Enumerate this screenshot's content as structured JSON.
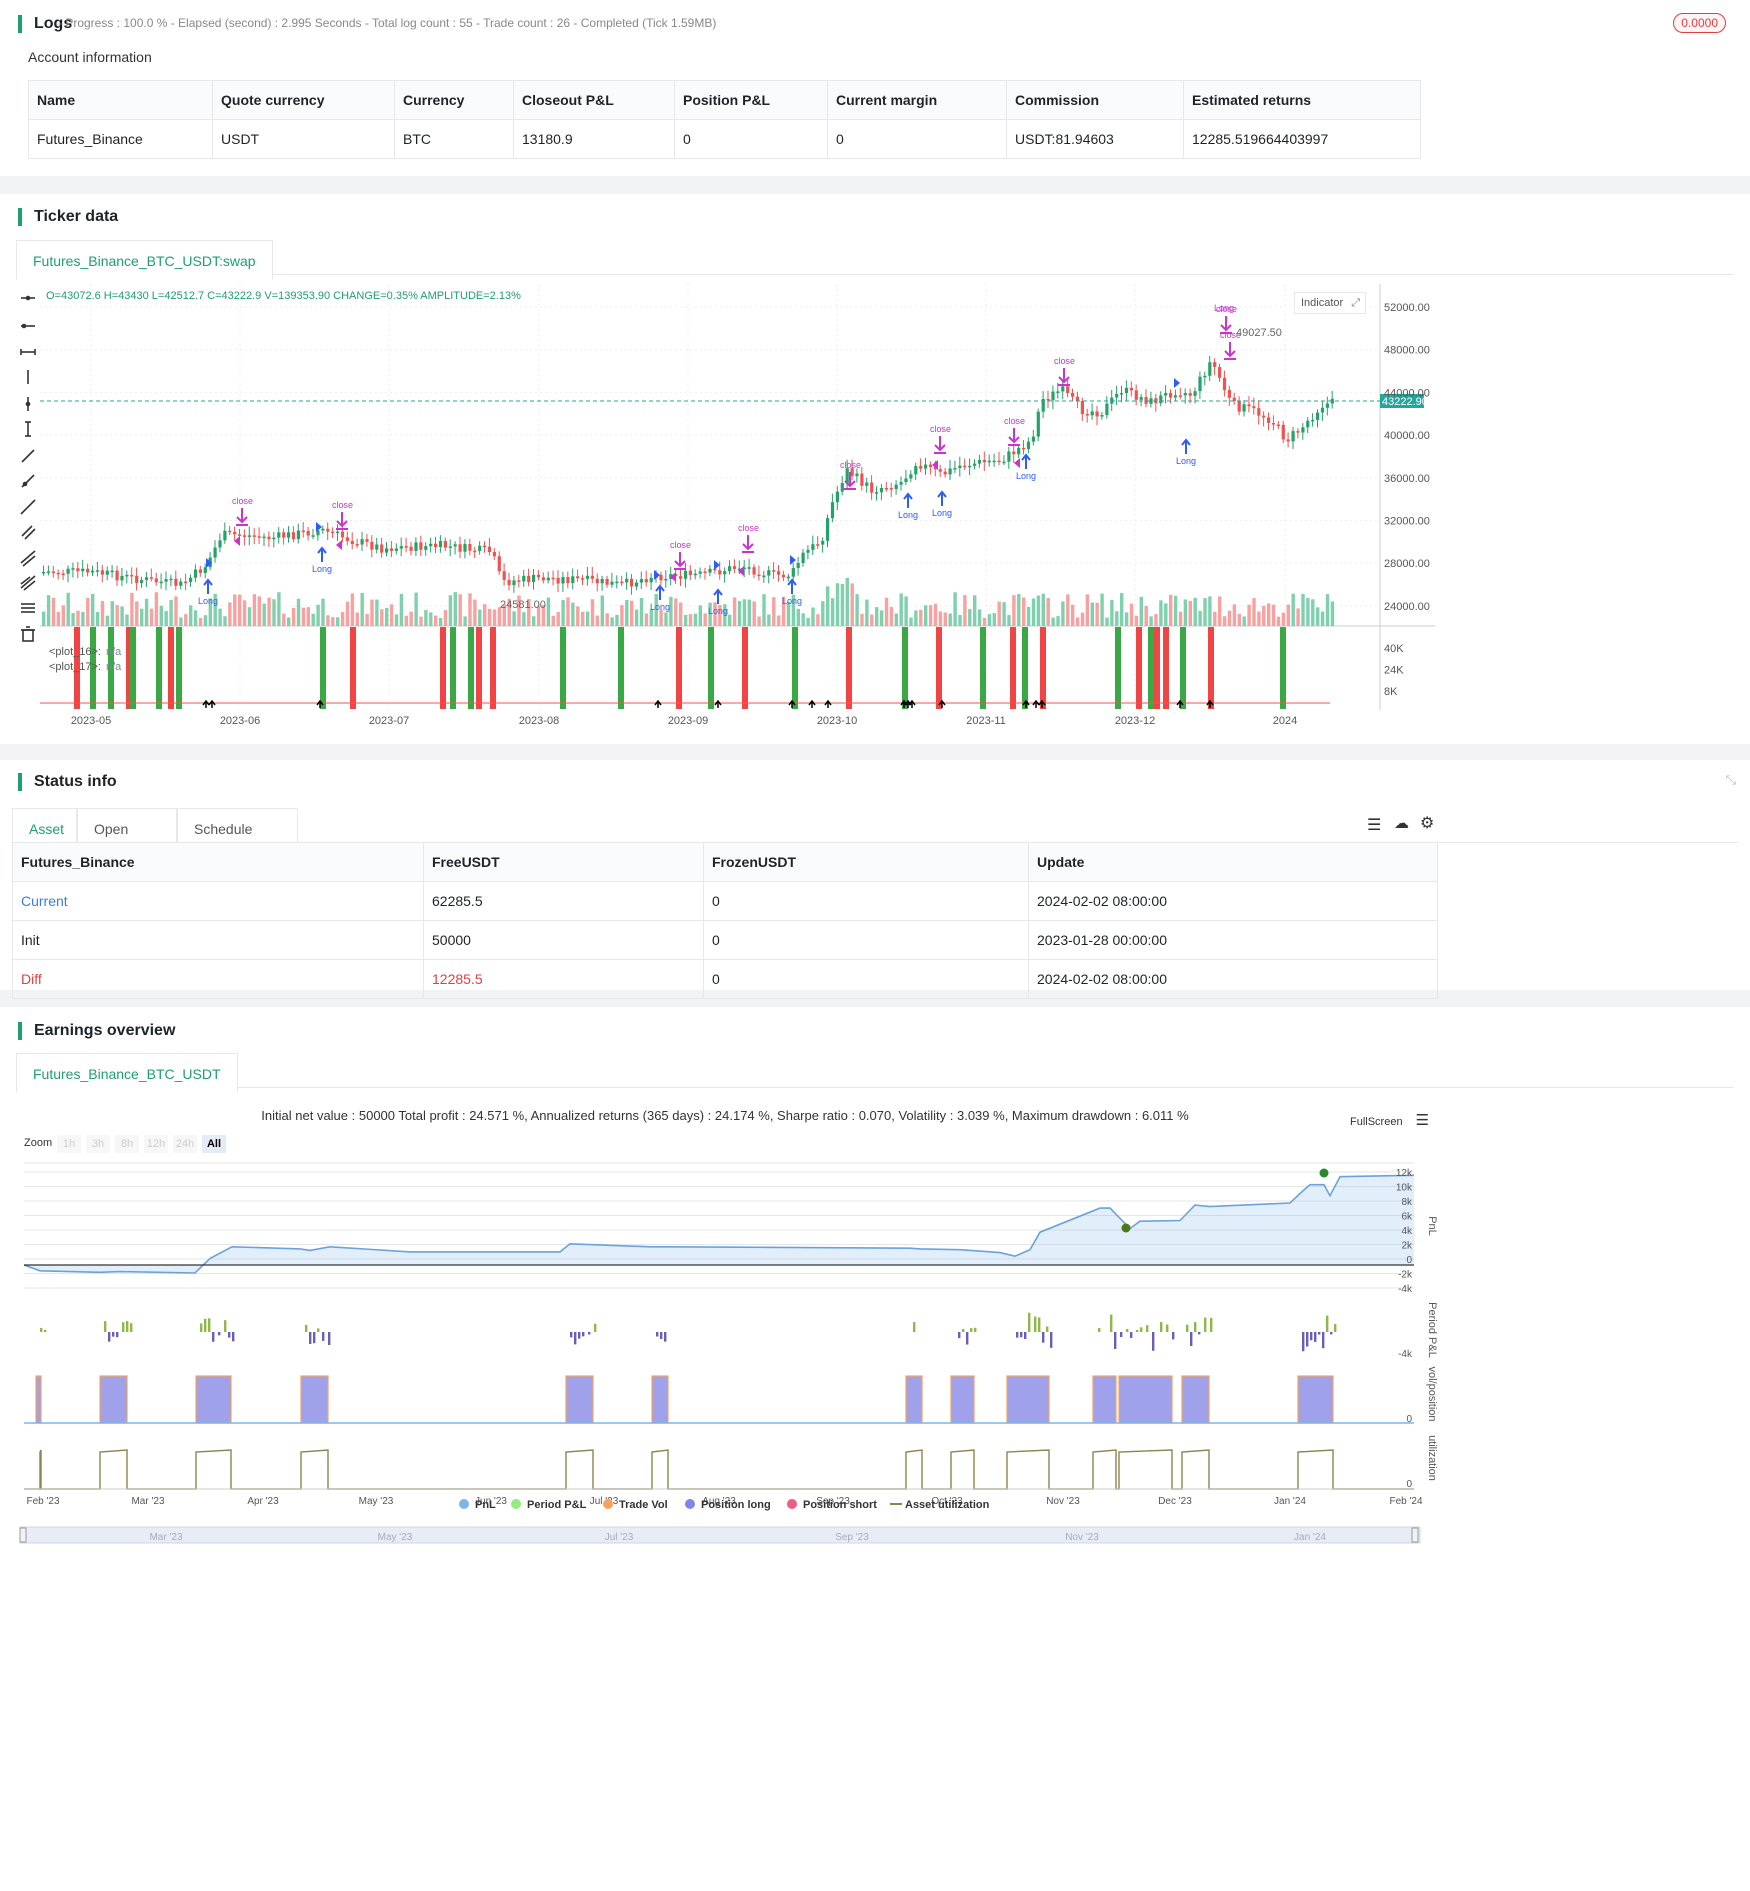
{
  "logs": {
    "title": "Logs",
    "status": "- Progress : 100.0 % - Elapsed (second) : 2.995  Seconds - Total log count : 55 - Trade count : 26 - Completed (Tick 1.59MB)",
    "badge": "0.0000",
    "account_title": "Account information",
    "table": {
      "headers": [
        "Name",
        "Quote currency",
        "Currency",
        "Closeout P&L",
        "Position P&L",
        "Current margin",
        "Commission",
        "Estimated returns"
      ],
      "row": [
        "Futures_Binance",
        "USDT",
        "BTC",
        "13180.9",
        "0",
        "0",
        "USDT:81.94603",
        "12285.519664403997"
      ]
    }
  },
  "ticker": {
    "title": "Ticker data",
    "tab": "Futures_Binance_BTC_USDT:swap",
    "ohlc": "O=43072.6 H=43430 L=42512.7 C=43222.9 V=139353.90 CHANGE=0.35% AMPLITUDE=2.13%",
    "indicator_btn": "Indicator",
    "last_price": "43222.90",
    "high_label": "49027.50",
    "low_label": "24581.00",
    "legend": [
      "<plot_16>:",
      "<plot_17>:"
    ],
    "legend_val": "n/a",
    "price_ticks": [
      "52000.00",
      "48000.00",
      "44000.00",
      "40000.00",
      "36000.00",
      "32000.00",
      "28000.00",
      "24000.00"
    ],
    "vol_ticks": [
      "40K",
      "24K",
      "8K"
    ],
    "x_ticks": [
      "2023-05",
      "2023-06",
      "2023-07",
      "2023-08",
      "2023-09",
      "2023-10",
      "2023-11",
      "2023-12",
      "2024"
    ],
    "marker_labels": {
      "long": "Long",
      "long_lc": "long",
      "close": "close",
      "one": "1"
    },
    "colors": {
      "up": "#26a269",
      "down": "#ef5350",
      "long": "#2d5cf6",
      "close": "#cc33cc"
    },
    "toolbar_icons": [
      "horizontal-line-icon",
      "horizontal-ray-icon",
      "extended-line-icon",
      "vertical-line-icon",
      "vertical-ray-icon",
      "vertical-segment-icon",
      "trend-line-icon",
      "ray-icon",
      "extended-trend-icon",
      "parallel-channel-icon",
      "pitchfork-icon",
      "fib-icon",
      "text-list-icon",
      "trash-icon"
    ]
  },
  "status": {
    "title": "Status info",
    "tabs": [
      "Asset",
      "Open orders",
      "Schedule orders"
    ],
    "headers": [
      "Futures_Binance",
      "FreeUSDT",
      "FrozenUSDT",
      "Update"
    ],
    "rows": [
      [
        "Current",
        "62285.5",
        "0",
        "2024-02-02 08:00:00"
      ],
      [
        "Init",
        "50000",
        "0",
        "2023-01-28 00:00:00"
      ],
      [
        "Diff",
        "12285.5",
        "0",
        "2024-02-02 08:00:00"
      ]
    ]
  },
  "earnings": {
    "title": "Earnings overview",
    "tab": "Futures_Binance_BTC_USDT",
    "summary": "Initial net value : 50000 Total profit : 24.571 %, Annualized returns (365 days) : 24.174 %, Sharpe ratio : 0.070, Volatility : 3.039 %, Maximum drawdown : 6.011 %",
    "fullscreen": "FullScreen",
    "zoom_label": "Zoom",
    "zoom_options": [
      "1h",
      "3h",
      "8h",
      "12h",
      "24h",
      "All"
    ],
    "zoom_active": "All",
    "pnl_ticks": [
      "12k",
      "10k",
      "8k",
      "6k",
      "4k",
      "2k",
      "0",
      "-2k",
      "-4k"
    ],
    "axis_titles": [
      "PnL",
      "Period P&L",
      "vol/position",
      "utilization"
    ],
    "period_ticks": [
      "-4k"
    ],
    "vol_zero": "0",
    "util_zero": "0",
    "x_ticks": [
      "Feb '23",
      "Mar '23",
      "Apr '23",
      "May '23",
      "Jun '23",
      "Jul '23",
      "Aug '23",
      "Sep '23",
      "Oct '23",
      "Nov '23",
      "Dec '23",
      "Jan '24",
      "Feb '24"
    ],
    "nav_ticks": [
      "Mar '23",
      "May '23",
      "Jul '23",
      "Sep '23",
      "Nov '23",
      "Jan '24"
    ],
    "legend": [
      {
        "label": "PnL",
        "color": "#7cb5ec"
      },
      {
        "label": "Period P&L",
        "color": "#90ed7d"
      },
      {
        "label": "Trade Vol",
        "color": "#f7a35c"
      },
      {
        "label": "Position long",
        "color": "#8085e9"
      },
      {
        "label": "Position short",
        "color": "#f15c80"
      },
      {
        "label": "Asset utilization",
        "color": "#8d8450"
      }
    ]
  },
  "chart_data": [
    {
      "type": "line",
      "title": "",
      "series": [
        {
          "name": "PnL",
          "values": [
            0,
            -800,
            -1000,
            -900,
            -1100,
            900,
            2500,
            2200,
            2000,
            2500,
            1800,
            1800,
            2900,
            2500,
            2500,
            2300,
            2200,
            2100,
            1700,
            1200,
            2100,
            4500,
            7800,
            7800,
            5000,
            6000,
            6100,
            8200,
            8000,
            8500,
            9800,
            11000,
            11000,
            9500,
            12100,
            12285
          ]
        }
      ],
      "ylim": [
        -4000,
        12000
      ]
    }
  ]
}
